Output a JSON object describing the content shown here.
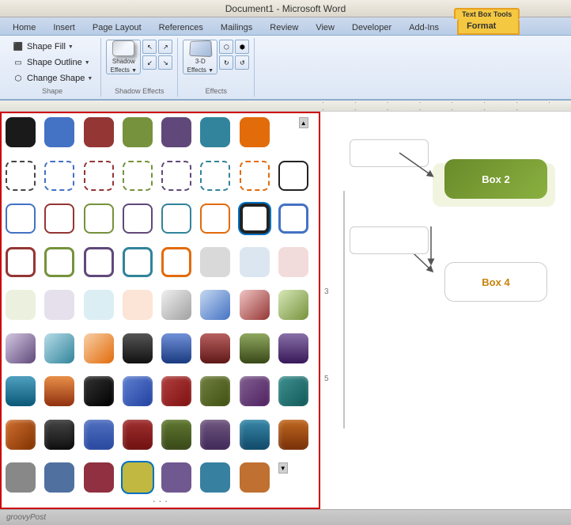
{
  "titleBar": {
    "text": "Document1 - Microsoft Word"
  },
  "tabs": [
    {
      "label": "Home",
      "active": false
    },
    {
      "label": "Insert",
      "active": false
    },
    {
      "label": "Page Layout",
      "active": false
    },
    {
      "label": "References",
      "active": false
    },
    {
      "label": "Mailings",
      "active": false
    },
    {
      "label": "Review",
      "active": false
    },
    {
      "label": "View",
      "active": false
    },
    {
      "label": "Developer",
      "active": false
    },
    {
      "label": "Add-Ins",
      "active": false
    },
    {
      "label": "Format",
      "active": true
    }
  ],
  "textBoxToolsLabel": "Text Box Tools",
  "formatTabLabel": "Format",
  "ribbonGroups": {
    "shapeGroup": {
      "label": "Shape",
      "shapeFill": "Shape Fill",
      "shapeOutline": "Shape Outline",
      "changeShape": "Change Shape"
    },
    "shadowEffectsGroup": {
      "label": "Shadow Effects",
      "buttonLabel": "Shadow\nEffects"
    },
    "effectsGroup": {
      "label": "Effects",
      "threedLabel": "3-D\nEffects"
    }
  },
  "statusBar": {
    "brand": "groovyPost"
  },
  "styleGrid": {
    "rows": [
      [
        "solid-black",
        "solid-blue",
        "solid-darkred",
        "solid-green",
        "solid-purple",
        "solid-teal",
        "solid-orange"
      ],
      [
        "dashed-black",
        "dashed-blue",
        "dashed-red",
        "dashed-green",
        "dashed-purple",
        "dashed-teal",
        "dashed-orange"
      ],
      [
        "outline-black",
        "outline-blue",
        "outline-red",
        "outline-green",
        "outline-purple",
        "outline-teal",
        "outline-orange"
      ],
      [
        "thick-black",
        "thick-blue",
        "thick-red",
        "thick-green",
        "thick-purple",
        "thick-teal",
        "thick-orange"
      ],
      [
        "gray-light",
        "blue-light",
        "red-light",
        "green-light",
        "purple-light",
        "teal-light",
        "orange-light"
      ],
      [
        "gray-grad",
        "blue-grad",
        "red-grad",
        "green-grad",
        "purple-grad",
        "teal-grad",
        "orange-grad"
      ],
      [
        "black-grad2",
        "blue-grad2",
        "red-grad2",
        "green-grad2",
        "purple-grad2",
        "teal-grad2",
        "orange-grad2"
      ],
      [
        "black-raised",
        "blue-raised",
        "red-raised",
        "green-raised",
        "purple-raised",
        "teal-raised",
        "orange-raised"
      ],
      [
        "black-inset",
        "blue-inset",
        "red-inset",
        "green-inset",
        "purple-inset",
        "teal-inset",
        "orange-inset"
      ],
      [
        "gray-flat",
        "blue-flat",
        "red-flat",
        "green-flat",
        "yellow-flat",
        "purple2-flat",
        "teal2-flat",
        "orange-flat"
      ]
    ]
  },
  "docBoxes": {
    "box2": "Box 2",
    "box4": "Box 4"
  }
}
